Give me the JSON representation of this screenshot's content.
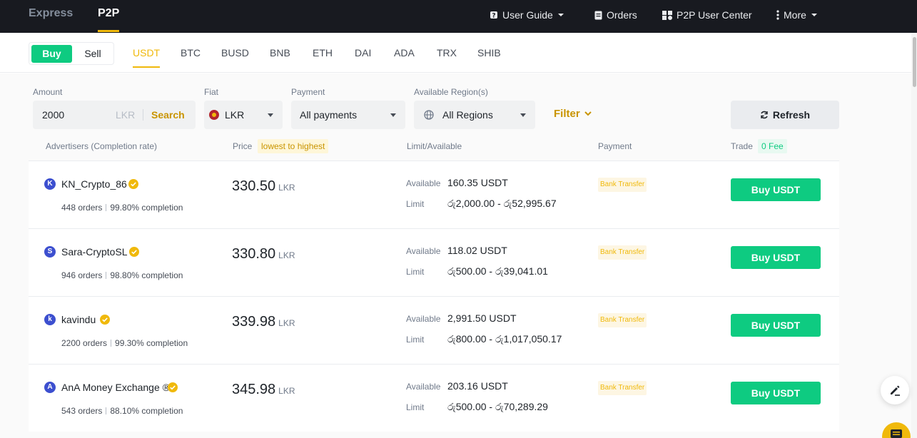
{
  "topnav": {
    "tabs": [
      {
        "label": "Express",
        "active": false
      },
      {
        "label": "P2P",
        "active": true
      }
    ],
    "user_guide": "User Guide",
    "orders": "Orders",
    "user_center": "P2P User Center",
    "more": "More"
  },
  "trade_toggle": {
    "buy": "Buy",
    "sell": "Sell"
  },
  "coins": [
    "USDT",
    "BTC",
    "BUSD",
    "BNB",
    "ETH",
    "DAI",
    "ADA",
    "TRX",
    "SHIB"
  ],
  "filters": {
    "amount_label": "Amount",
    "amount_value": "2000",
    "amount_currency": "LKR",
    "search": "Search",
    "fiat_label": "Fiat",
    "fiat_value": "LKR",
    "payment_label": "Payment",
    "payment_value": "All payments",
    "region_label": "Available Region(s)",
    "region_value": "All Regions",
    "filter": "Filter",
    "refresh": "Refresh"
  },
  "table_header": {
    "advertisers": "Advertisers (Completion rate)",
    "price": "Price",
    "sort_badge": "lowest to highest",
    "limit": "Limit/Available",
    "payment": "Payment",
    "trade": "Trade",
    "fee_badge": "0 Fee"
  },
  "labels": {
    "available": "Available",
    "limit": "Limit"
  },
  "rows": [
    {
      "initial": "K",
      "name": "KN_Crypto_86",
      "orders": "448 orders",
      "completion": "99.80% completion",
      "price": "330.50",
      "currency": "LKR",
      "available": "160.35 USDT",
      "limit": "රු2,000.00 - රු52,995.67",
      "payment": "Bank Transfer",
      "button": "Buy USDT"
    },
    {
      "initial": "S",
      "name": "Sara-CryptoSL",
      "orders": "946 orders",
      "completion": "98.80% completion",
      "price": "330.80",
      "currency": "LKR",
      "available": "118.02 USDT",
      "limit": "රු500.00 - රු39,041.01",
      "payment": "Bank Transfer",
      "button": "Buy USDT"
    },
    {
      "initial": "k",
      "name": "kavindu",
      "orders": "2200 orders",
      "completion": "99.30% completion",
      "price": "339.98",
      "currency": "LKR",
      "available": "2,991.50 USDT",
      "limit": "රු800.00 - රු1,017,050.17",
      "payment": "Bank Transfer",
      "button": "Buy USDT"
    },
    {
      "initial": "A",
      "name": "AnA Money Exchange ®",
      "orders": "543 orders",
      "completion": "88.10% completion",
      "price": "345.98",
      "currency": "LKR",
      "available": "203.16 USDT",
      "limit": "රු500.00 - රු70,289.29",
      "payment": "Bank Transfer",
      "button": "Buy USDT"
    }
  ],
  "colors": {
    "accent": "#f0b90b",
    "buy": "#0ecb81",
    "nav_bg": "#181a20"
  }
}
